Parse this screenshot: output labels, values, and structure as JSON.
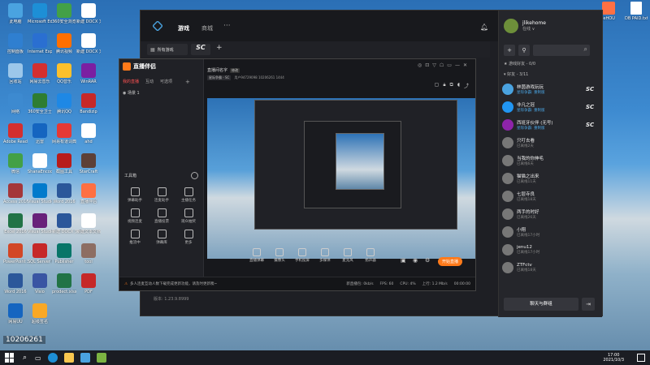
{
  "desktop": {
    "icons": [
      {
        "label": "此电脑",
        "color": "#4aa3e0"
      },
      {
        "label": "Microsoft Edge",
        "color": "#1d8fd6"
      },
      {
        "label": "360安全浏览器",
        "color": "#43a047"
      },
      {
        "label": "新建 DOCX 文档",
        "color": "#ffffff"
      },
      {
        "label": "控制面板",
        "color": "#2f7fd0"
      },
      {
        "label": "Internet Explorer",
        "color": "#2a6fd1"
      },
      {
        "label": "腾讯视频",
        "color": "#ff6f00"
      },
      {
        "label": "新建 DOCX 文档",
        "color": "#ffffff"
      },
      {
        "label": "回收站",
        "color": "#9cc7ea"
      },
      {
        "label": "网易云音乐",
        "color": "#d32f2f"
      },
      {
        "label": "QQ音乐",
        "color": "#fbc02d"
      },
      {
        "label": "WinRAR",
        "color": "#7b1fa2"
      },
      {
        "label": "网络",
        "color": "#3d8ad0"
      },
      {
        "label": "360安全卫士",
        "color": "#2e7d32"
      },
      {
        "label": "腾讯QQ",
        "color": "#1e88e5"
      },
      {
        "label": "Bandizip",
        "color": "#c62828"
      },
      {
        "label": "Adobe Reader XI",
        "color": "#d32f2f"
      },
      {
        "label": "迅雷",
        "color": "#1565c0"
      },
      {
        "label": "网易有道词典",
        "color": "#e53935"
      },
      {
        "label": "ahd",
        "color": "#ffffff"
      },
      {
        "label": "微信",
        "color": "#43a047"
      },
      {
        "label": "ShanaEncoder",
        "color": "#ffffff"
      },
      {
        "label": "截图工具",
        "color": "#b71c1c"
      },
      {
        "label": "StarCraft",
        "color": "#5d4037"
      },
      {
        "label": "Access 2016",
        "color": "#a4373a"
      },
      {
        "label": "Visual Studio Code",
        "color": "#007acc"
      },
      {
        "label": "Word 2016",
        "color": "#2b579a"
      },
      {
        "label": "直播伴侣",
        "color": "#ff7043"
      },
      {
        "label": "Excel 2016",
        "color": "#217346"
      },
      {
        "label": "Visual Studio 2019",
        "color": "#68217a"
      },
      {
        "label": "新建 DOCX 文档",
        "color": "#2b579a"
      },
      {
        "label": "新建文本文档",
        "color": "#ffffff"
      },
      {
        "label": "PowerPoint 2016",
        "color": "#d24726"
      },
      {
        "label": "SQL Server Management",
        "color": "#c62828"
      },
      {
        "label": "Publisher",
        "color": "#077568"
      },
      {
        "label": "tool",
        "color": "#8d6e63"
      },
      {
        "label": "Word 2016",
        "color": "#2b579a"
      },
      {
        "label": "Visio",
        "color": "#3955a3"
      },
      {
        "label": "prodect.xlsx",
        "color": "#217346"
      },
      {
        "label": "PDF",
        "color": "#c62828"
      },
      {
        "label": "网易UU",
        "color": "#1565c0"
      },
      {
        "label": "超级签名",
        "color": "#f9a825"
      }
    ],
    "top_right_labels": [
      "jeHOU",
      "DB PAID.txt"
    ],
    "overlay_label": "10206261"
  },
  "main_window": {
    "nav": [
      "游戏",
      "商城"
    ],
    "more": "···",
    "tab_label": "所有游戏",
    "tab_logo": "SC",
    "add_tab": "+",
    "version": "版本: 1.23.9.8999",
    "user": {
      "name": "jlikehome",
      "status": "在线 ∨"
    },
    "search_placeholder": "",
    "groups": [
      {
        "label": "★ 游戏好友 - 0/0"
      },
      {
        "label": "▾ 好友 - 3/11"
      }
    ],
    "friends": [
      {
        "name": "林茵游戏玩玩",
        "status": "星际争霸: 重制版",
        "badge": "SC",
        "color": "#4aa3e0",
        "online": true
      },
      {
        "name": "非凡之冠",
        "status": "星际争霸: 重制版",
        "badge": "SC",
        "color": "#2196f3",
        "online": true
      },
      {
        "name": "西班牙伙伴 (无号)",
        "status": "星际争霸: 重制版",
        "badge": "SC",
        "color": "#8e24aa",
        "online": true
      },
      {
        "name": "只叮去看",
        "status": "已离线2天",
        "badge": "",
        "color": "#777",
        "online": false
      },
      {
        "name": "当我的你伸毛",
        "status": "已离线6天",
        "badge": "",
        "color": "#777",
        "online": false
      },
      {
        "name": "猫猫之出来",
        "status": "已离线11天",
        "badge": "",
        "color": "#777",
        "online": false
      },
      {
        "name": "七层寺良",
        "status": "已离线18天",
        "badge": "",
        "color": "#777",
        "online": false
      },
      {
        "name": "两手的时好",
        "status": "已离线26天",
        "badge": "",
        "color": "#777",
        "online": false
      },
      {
        "name": "小翔",
        "status": "已离线17小时",
        "badge": "",
        "color": "#777",
        "online": false
      },
      {
        "name": "jenu12",
        "status": "已离线17小时",
        "badge": "",
        "color": "#777",
        "online": false
      },
      {
        "name": "ZTFctv",
        "status": "已离线18天",
        "badge": "",
        "color": "#777",
        "online": false
      }
    ],
    "chat_button": "聊天与群组",
    "exit_icon": "⇥"
  },
  "stream_window": {
    "title": "直播伴侣",
    "nav_tabs": [
      "我的直播",
      "互动",
      "可选项"
    ],
    "scene": "场景 1",
    "tool_section": "工具箱",
    "tools": [
      "弹幕助手",
      "连麦助手",
      "主播任务",
      "视频连麦",
      "直播投票",
      "观众抽奖",
      "推流中",
      "弹幕库",
      "更多"
    ],
    "live_title": "直播间名字",
    "live_tag": "修改",
    "game_tag": "星际争霸 - SC",
    "stats": "用户94729098    10206261    1444",
    "bottom_tools": [
      "直播弹幕",
      "摄像头",
      "手机投屏",
      "多媒体",
      "麦克风",
      "扬声器"
    ],
    "start_button": "开始直播",
    "status_text": "多人连麦互动人数下载完成更新功能，请及时更新噢~",
    "status_right": [
      "新直播包: 0kb/s",
      "FPS: 60",
      "CPU: 4%",
      "上行: 1.2 Mb/s",
      "00:00:00"
    ]
  },
  "taskbar": {
    "time": "17:00",
    "date": "2021/10/3"
  }
}
